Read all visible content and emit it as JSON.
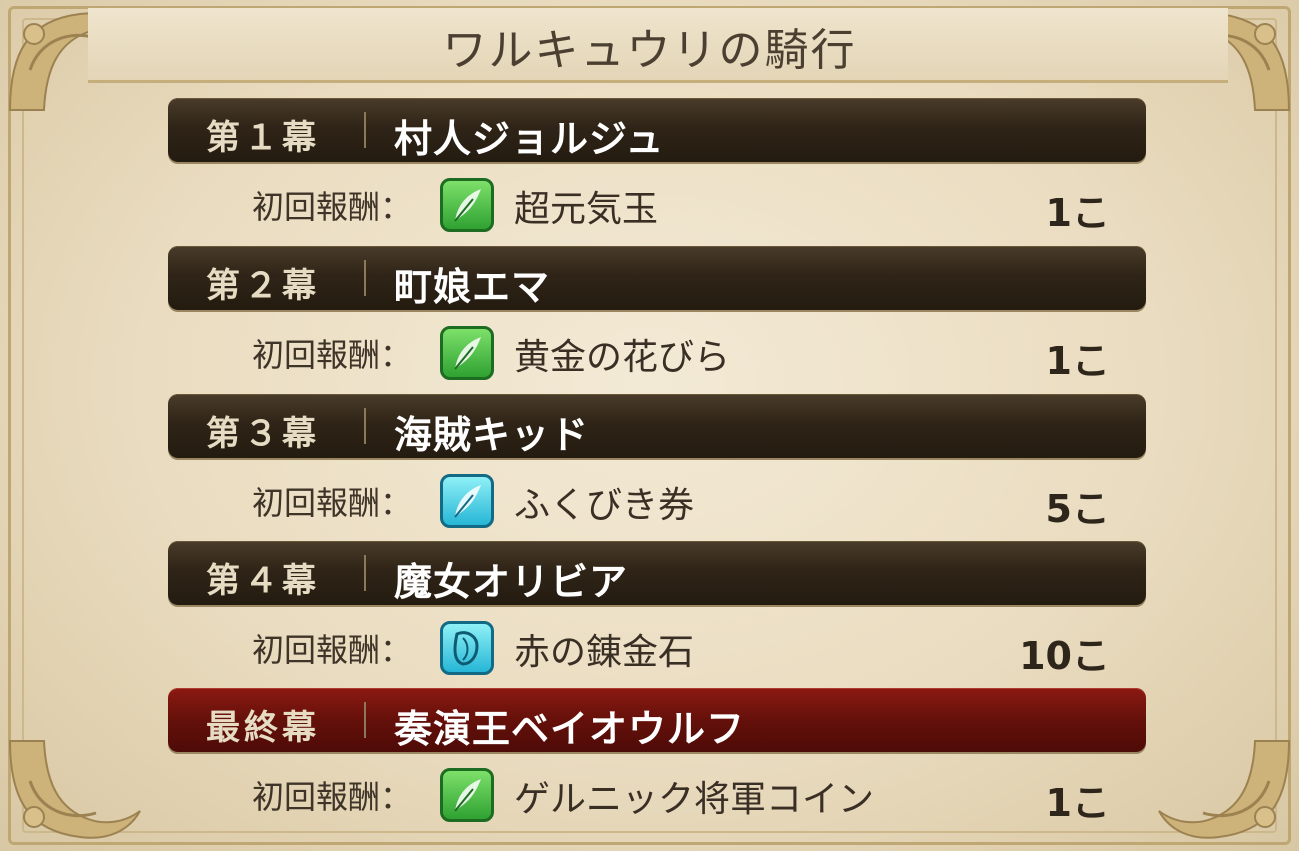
{
  "title": "ワルキュウリの騎行",
  "reward_label": "初回報酬：",
  "chapters": [
    {
      "act": "第１幕",
      "name": "村人ジョルジュ",
      "reward_icon": "green-feather-icon",
      "reward_item": "超元気玉",
      "quantity": "1こ",
      "final": false
    },
    {
      "act": "第２幕",
      "name": "町娘エマ",
      "reward_icon": "green-feather-icon",
      "reward_item": "黄金の花びら",
      "quantity": "1こ",
      "final": false
    },
    {
      "act": "第３幕",
      "name": "海賊キッド",
      "reward_icon": "blue-feather-icon",
      "reward_item": "ふくびき券",
      "quantity": "5こ",
      "final": false
    },
    {
      "act": "第４幕",
      "name": "魔女オリビア",
      "reward_icon": "blue-stone-icon",
      "reward_item": "赤の錬金石",
      "quantity": "10こ",
      "final": false
    },
    {
      "act": "最終幕",
      "name": "奏演王ベイオウルフ",
      "reward_icon": "green-feather-icon",
      "reward_item": "ゲルニック将軍コイン",
      "quantity": "1こ",
      "final": true
    }
  ],
  "colors": {
    "parchment": "#eadcc0",
    "header_dark": "#2f2417",
    "header_final": "#65100a",
    "text_brown": "#3f3428"
  }
}
